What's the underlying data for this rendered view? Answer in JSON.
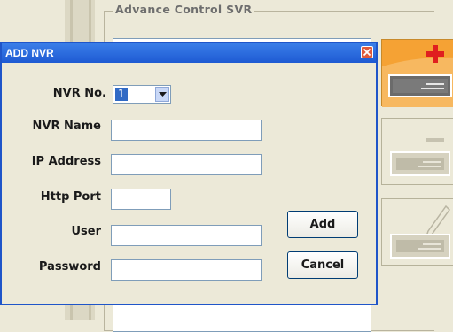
{
  "background": {
    "group_title": "Advance Control SVR",
    "side_buttons": [
      {
        "name": "add",
        "icon": "nvr-add-icon",
        "state": "active"
      },
      {
        "name": "remove",
        "icon": "nvr-remove-icon",
        "state": "disabled"
      },
      {
        "name": "edit",
        "icon": "nvr-edit-icon",
        "state": "disabled"
      }
    ]
  },
  "dialog": {
    "title": "ADD NVR",
    "close_icon": "close-icon",
    "fields": {
      "nvr_no": {
        "label": "NVR No.",
        "value": "1"
      },
      "nvr_name": {
        "label": "NVR Name",
        "value": ""
      },
      "ip_address": {
        "label": "IP Address",
        "value": ""
      },
      "http_port": {
        "label": "Http Port",
        "value": ""
      },
      "user": {
        "label": "User",
        "value": ""
      },
      "password": {
        "label": "Password",
        "value": ""
      }
    },
    "buttons": {
      "add": "Add",
      "cancel": "Cancel"
    }
  },
  "colors": {
    "titlebar": "#1e5ad3",
    "active_button": "#f5a234",
    "plus_sign": "#e01f1f",
    "selection": "#316ac5"
  }
}
